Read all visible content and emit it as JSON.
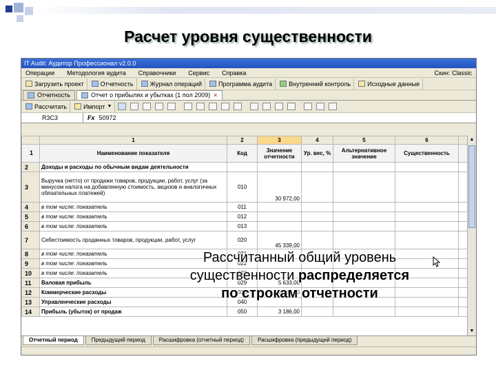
{
  "slide": {
    "title": "Расчет уровня существенности",
    "overlay_line1": "Рассчитанный общий уровень",
    "overlay_line2a": "существенности ",
    "overlay_line2b": "распределяется",
    "overlay_line3": "по строкам отчетности"
  },
  "app": {
    "window_title": "IT Audit: Аудитор Профессионал v2.0.0",
    "menu": [
      "Операции",
      "Методология аудита",
      "Справочники",
      "Сервис",
      "Справка"
    ],
    "menu_right": "Скин: Сlassic ",
    "toolbar": [
      {
        "label": "Загрузить проект",
        "icon": "folder-open-icon"
      },
      {
        "label": "Отчетность",
        "icon": "report-icon"
      },
      {
        "label": "Журнал операций",
        "icon": "journal-icon"
      },
      {
        "label": "Программа аудита",
        "icon": "program-icon"
      },
      {
        "label": "Внутренний контроль",
        "icon": "control-icon"
      },
      {
        "label": "Исходные данные",
        "icon": "source-data-icon"
      }
    ],
    "doc_tabs": [
      {
        "label": "Отчетность",
        "active": false
      },
      {
        "label": "Отчет о прибылях и убытках (1 пол 2009)",
        "active": true
      }
    ],
    "toolbar2": {
      "calc_label": "Рассчитать",
      "import_label": "Импорт"
    },
    "formula": {
      "cell_ref": "R3C3",
      "fx": "Fx",
      "value": "50972"
    }
  },
  "grid": {
    "col_numbers": [
      "1",
      "2",
      "3",
      "4",
      "5",
      "6"
    ],
    "headers": [
      "Наименование показателя",
      "Код",
      "Значение отчетности",
      "Ур. вес, %",
      "Альтернативное значение",
      "Существенность"
    ],
    "rows": [
      {
        "num": "2",
        "name": "Доходы и расходы по обычным видам деятельности",
        "code": "",
        "value": "",
        "style": "bold"
      },
      {
        "num": "3",
        "name": "Выручка (нетто) от продажи товаров, продукции, работ, услуг (за минусом налога на добавленную стоимость, акцизов и аналогичных обязательных платежей)",
        "code": "010",
        "value": "30 972,00",
        "style": "wrap",
        "tall": true,
        "active": true
      },
      {
        "num": "4",
        "name": "в том числе: показатель",
        "code": "011",
        "value": "",
        "style": "ital"
      },
      {
        "num": "5",
        "name": "в том числе: показатель",
        "code": "012",
        "value": "",
        "style": "ital"
      },
      {
        "num": "6",
        "name": "в том числе: показатель",
        "code": "013",
        "value": "",
        "style": "ital"
      },
      {
        "num": "7",
        "name": "Себестоимость проданных товаров, продукции, работ, услуг",
        "code": "020",
        "value": "45 339,00",
        "style": "wrap",
        "mid": true
      },
      {
        "num": "8",
        "name": "в том числе: показатель",
        "code": "021",
        "value": "",
        "style": "ital"
      },
      {
        "num": "9",
        "name": "в том числе: показатель",
        "code": "022",
        "value": "",
        "style": "ital"
      },
      {
        "num": "10",
        "name": "в том числе: показатель",
        "code": "023",
        "value": "",
        "style": "ital"
      },
      {
        "num": "11",
        "name": "Валовая прибыль",
        "code": "029",
        "value": "5 633,00",
        "style": "bold"
      },
      {
        "num": "12",
        "name": "Коммерческие расходы",
        "code": "030",
        "value": "2 447,00",
        "style": "bold"
      },
      {
        "num": "13",
        "name": "Управленческие расходы",
        "code": "040",
        "value": "",
        "style": "bold"
      },
      {
        "num": "14",
        "name": "Прибыль (убыток) от продаж",
        "code": "050",
        "value": "3 186,00",
        "style": "bold"
      }
    ]
  },
  "sheet_tabs": [
    {
      "label": "Отчетный период",
      "active": true
    },
    {
      "label": "Предыдущий период",
      "active": false
    },
    {
      "label": "Расшифровка (отчетный период)",
      "active": false
    },
    {
      "label": "Расшифровка (предыдущий период)",
      "active": false
    }
  ],
  "colors": {
    "title_bar": "#2453c0",
    "selected_col": "#fbd98a",
    "deco_blue": "#1f3f8f",
    "deco_light": "#9fb3d9"
  }
}
